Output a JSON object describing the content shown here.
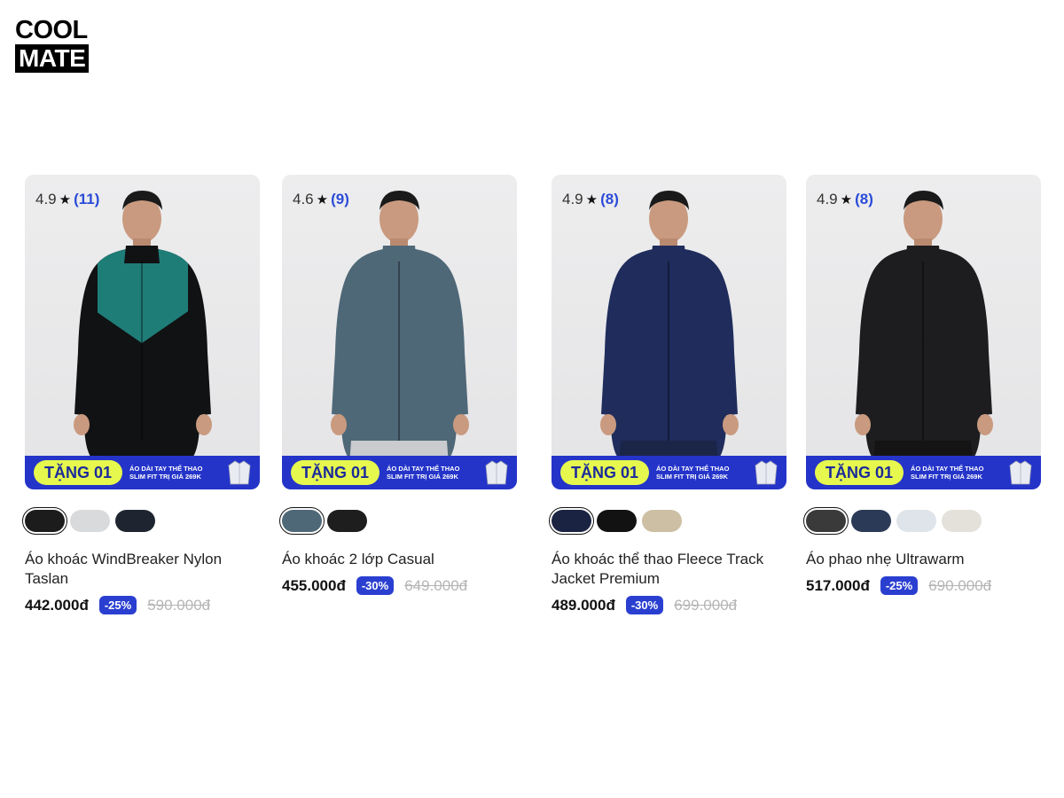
{
  "brand": {
    "logo_top": "COOL",
    "logo_bottom": "MATE"
  },
  "colors": {
    "accent": "#2a3fd0",
    "promo_bg": "#2434c9",
    "promo_pill": "#e6f84d"
  },
  "products": [
    {
      "rating": "4.9",
      "reviews": "(11)",
      "promo_pill": "TẶNG 01",
      "promo_line1": "ÁO DÀI TAY THỂ THAO",
      "promo_line2": "SLIM FIT TRỊ GIÁ 269K",
      "name": "Áo khoác WindBreaker Nylon Taslan",
      "price": "442.000đ",
      "discount": "-25%",
      "old_price": "590.000đ",
      "swatches": [
        "#1c1c1c",
        "#d9dadc",
        "#1f2530"
      ],
      "jacket_top": "#1f7d78",
      "jacket_body": "#111214",
      "pants": "#111214"
    },
    {
      "rating": "4.6",
      "reviews": "(9)",
      "promo_pill": "TẶNG 01",
      "promo_line1": "ÁO DÀI TAY THỂ THAO",
      "promo_line2": "SLIM FIT TRỊ GIÁ 269K",
      "name": "Áo khoác 2 lớp Casual",
      "price": "455.000đ",
      "discount": "-30%",
      "old_price": "649.000đ",
      "swatches": [
        "#4f6877",
        "#1e1e1e"
      ],
      "jacket_top": "#4f6877",
      "jacket_body": "#4f6877",
      "pants": "#c9cbcf"
    },
    {
      "rating": "4.9",
      "reviews": "(8)",
      "promo_pill": "TẶNG 01",
      "promo_line1": "ÁO DÀI TAY THỂ THAO",
      "promo_line2": "SLIM FIT TRỊ GIÁ 269K",
      "name": "Áo khoác thể thao Fleece Track Jacket Premium",
      "price": "489.000đ",
      "discount": "-30%",
      "old_price": "699.000đ",
      "swatches": [
        "#1b2342",
        "#121212",
        "#cdbfa3"
      ],
      "jacket_top": "#1f2c5c",
      "jacket_body": "#1f2c5c",
      "pants": "#1b2548"
    },
    {
      "rating": "4.9",
      "reviews": "(8)",
      "promo_pill": "TẶNG 01",
      "promo_line1": "ÁO DÀI TAY THỂ THAO",
      "promo_line2": "SLIM FIT TRỊ GIÁ 269K",
      "name": "Áo phao nhẹ Ultrawarm",
      "price": "517.000đ",
      "discount": "-25%",
      "old_price": "690.000đ",
      "swatches": [
        "#3a3a3a",
        "#2b3a56",
        "#dfe4ea",
        "#e3e1da"
      ],
      "jacket_top": "#1d1d1f",
      "jacket_body": "#1d1d1f",
      "pants": "#141414"
    }
  ]
}
